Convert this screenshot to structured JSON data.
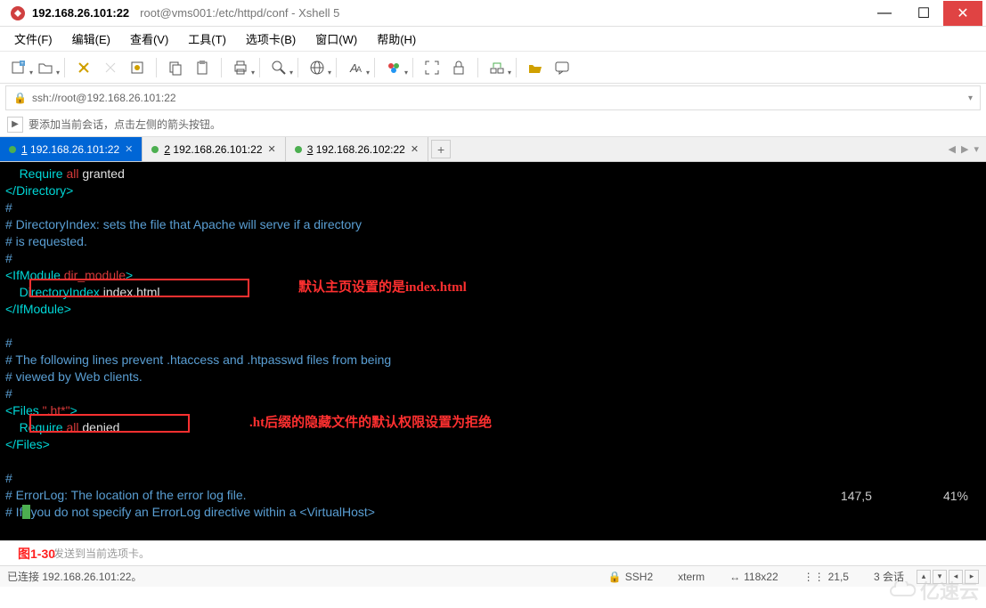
{
  "window": {
    "title_ip": "192.168.26.101:22",
    "title_path": "root@vms001:/etc/httpd/conf - Xshell 5"
  },
  "menu": {
    "file": "文件(F)",
    "edit": "编辑(E)",
    "view": "查看(V)",
    "tools": "工具(T)",
    "tabs": "选项卡(B)",
    "window": "窗口(W)",
    "help": "帮助(H)"
  },
  "address": {
    "url": "ssh://root@192.168.26.101:22"
  },
  "infobar": {
    "text": "要添加当前会话，点击左侧的箭头按钮。"
  },
  "tabs": [
    {
      "num": "1",
      "label": "192.168.26.101:22",
      "active": true
    },
    {
      "num": "2",
      "label": "192.168.26.101:22",
      "active": false
    },
    {
      "num": "3",
      "label": "192.168.26.102:22",
      "active": false
    }
  ],
  "terminal": {
    "lines": [
      {
        "segs": [
          [
            "wh",
            "    "
          ],
          [
            "cy",
            "Require "
          ],
          [
            "rd",
            "all "
          ],
          [
            "wh",
            "granted"
          ]
        ]
      },
      {
        "segs": [
          [
            "cy",
            "</Directory>"
          ]
        ]
      },
      {
        "segs": [
          [
            "bl",
            "#"
          ]
        ]
      },
      {
        "segs": [
          [
            "bl",
            "# DirectoryIndex: sets the file that Apache will serve if a directory"
          ]
        ]
      },
      {
        "segs": [
          [
            "bl",
            "# is requested."
          ]
        ]
      },
      {
        "segs": [
          [
            "bl",
            "#"
          ]
        ]
      },
      {
        "segs": [
          [
            "cy",
            "<IfModule "
          ],
          [
            "rd",
            "dir_module"
          ],
          [
            "cy",
            ">"
          ]
        ]
      },
      {
        "segs": [
          [
            "wh",
            "    "
          ],
          [
            "cy",
            "DirectoryIndex "
          ],
          [
            "wh",
            "index.html"
          ]
        ]
      },
      {
        "segs": [
          [
            "cy",
            "</IfModule>"
          ]
        ]
      },
      {
        "segs": [
          [
            "wh",
            ""
          ]
        ]
      },
      {
        "segs": [
          [
            "bl",
            "#"
          ]
        ]
      },
      {
        "segs": [
          [
            "bl",
            "# The following lines prevent .htaccess and .htpasswd files from being"
          ]
        ]
      },
      {
        "segs": [
          [
            "bl",
            "# viewed by Web clients."
          ]
        ]
      },
      {
        "segs": [
          [
            "bl",
            "#"
          ]
        ]
      },
      {
        "segs": [
          [
            "cy",
            "<Files "
          ],
          [
            "rd",
            "\".ht*\""
          ],
          [
            "cy",
            ">"
          ]
        ]
      },
      {
        "segs": [
          [
            "wh",
            "    "
          ],
          [
            "cy",
            "Require "
          ],
          [
            "rd",
            "all "
          ],
          [
            "wh",
            "denied"
          ]
        ]
      },
      {
        "segs": [
          [
            "cy",
            "</Files>"
          ]
        ]
      },
      {
        "segs": [
          [
            "wh",
            ""
          ]
        ]
      },
      {
        "segs": [
          [
            "bl",
            "#"
          ]
        ]
      },
      {
        "segs": [
          [
            "bl",
            "# ErrorLog: The location of the error log file."
          ]
        ]
      },
      {
        "segs": [
          [
            "bl",
            "# If"
          ],
          [
            "cursor",
            ""
          ],
          [
            "bl",
            "you do not specify an ErrorLog directive within a <VirtualHost>"
          ]
        ]
      }
    ],
    "status_pos": "147,5",
    "status_pct": "41%"
  },
  "annotations": {
    "a1": "默认主页设置的是index.html",
    "a2": ".ht后缀的隐藏文件的默认权限设置为拒绝"
  },
  "inputbar": {
    "hint": "发送到当前选项卡。",
    "figure": "图1-30"
  },
  "status": {
    "connected": "已连接 192.168.26.101:22。",
    "proto": "SSH2",
    "term": "xterm",
    "size": "118x22",
    "cursor": "21,5",
    "sessions": "3 会话"
  },
  "watermark": "亿速云"
}
